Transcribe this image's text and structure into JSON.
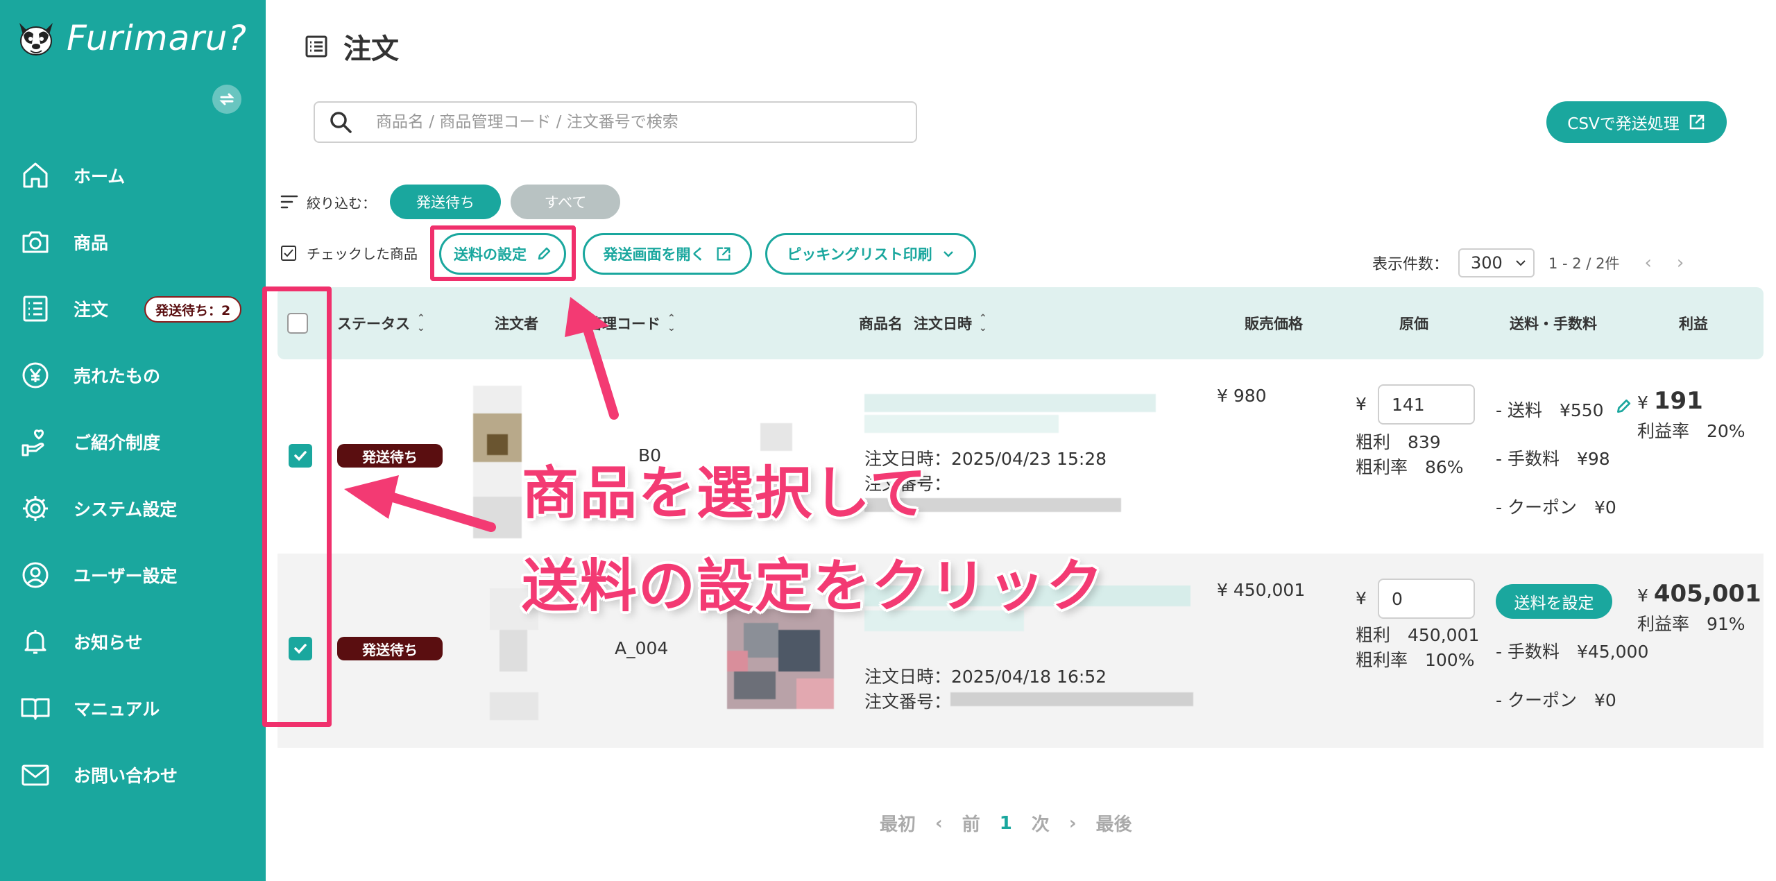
{
  "brand": {
    "name": "Furimaru?"
  },
  "sidebar": {
    "items": [
      {
        "label": "ホーム",
        "icon": "home-icon"
      },
      {
        "label": "商品",
        "icon": "camera-icon"
      },
      {
        "label": "注文",
        "icon": "list-icon",
        "badge": "発送待ち：2"
      },
      {
        "label": "売れたもの",
        "icon": "yen-circle-icon"
      },
      {
        "label": "ご紹介制度",
        "icon": "heart-hand-icon"
      },
      {
        "label": "システム設定",
        "icon": "gear-icon"
      },
      {
        "label": "ユーザー設定",
        "icon": "user-circle-icon"
      },
      {
        "label": "お知らせ",
        "icon": "bell-icon"
      },
      {
        "label": "マニュアル",
        "icon": "book-icon"
      },
      {
        "label": "お問い合わせ",
        "icon": "mail-icon"
      }
    ]
  },
  "page": {
    "title": "注文"
  },
  "search": {
    "placeholder": "商品名 / 商品管理コード / 注文番号で検索"
  },
  "csv_button": "CSVで発送処理",
  "filter": {
    "label": "絞り込む：",
    "options": [
      "発送待ち",
      "すべて"
    ],
    "selected": "発送待ち"
  },
  "bulk": {
    "label": "チェックした商品",
    "shipping_settings": "送料の設定",
    "open_shipping": "発送画面を開く",
    "picking_list": "ピッキングリスト印刷"
  },
  "pagination_top": {
    "per_page_label": "表示件数：",
    "per_page": "300",
    "range": "1 - 2 / 2件"
  },
  "table": {
    "headers": {
      "status": "ステータス",
      "buyer": "注文者",
      "code": "管理コード",
      "product": "商品名",
      "order_date": "注文日時",
      "price": "販売価格",
      "cost": "原価",
      "fees": "送料・手数料",
      "profit": "利益"
    },
    "rows": [
      {
        "checked": true,
        "status": "発送待ち",
        "code": "B0",
        "order_date": "注文日時：2025/04/23 15:28",
        "order_no_label": "注文番号：",
        "price": "¥ 980",
        "currency": "¥",
        "cost": "141",
        "gross_profit": "粗利　839",
        "gross_rate": "粗利率　86%",
        "shipping": "- 送料　¥550",
        "fee": "- 手数料　¥98",
        "coupon": "- クーポン　¥0",
        "profit_currency": "¥",
        "profit": "191",
        "profit_rate": "利益率　20%"
      },
      {
        "checked": true,
        "status": "発送待ち",
        "code": "A_004",
        "order_date": "注文日時：2025/04/18 16:52",
        "order_no_label": "注文番号：",
        "price": "¥ 450,001",
        "currency": "¥",
        "cost": "0",
        "gross_profit": "粗利　450,001",
        "gross_rate": "粗利率　100%",
        "shipping_button": "送料を設定",
        "fee": "- 手数料　¥45,000",
        "coupon": "- クーポン　¥0",
        "profit_currency": "¥",
        "profit": "405,001",
        "profit_rate": "利益率　91%"
      }
    ]
  },
  "pagination_bottom": {
    "first": "最初",
    "prev": "前",
    "current": "1",
    "next": "次",
    "last": "最後"
  },
  "annotation": {
    "line1": "商品を選択して",
    "line2": "送料の設定をクリック"
  },
  "colors": {
    "teal": "#1aa79e",
    "badge": "#5a0e10",
    "highlight": "#f0306c"
  }
}
